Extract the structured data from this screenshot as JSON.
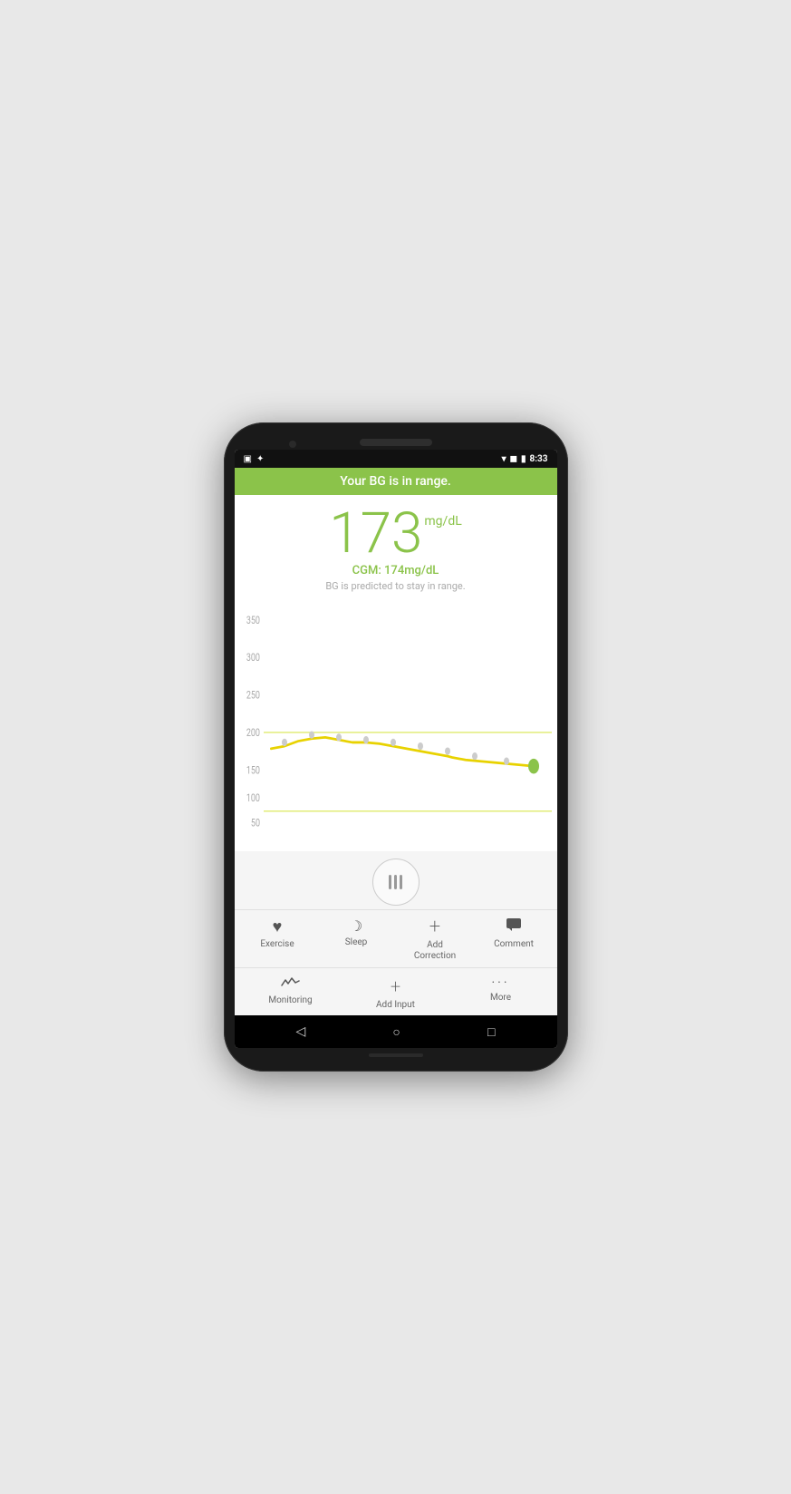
{
  "status_bar": {
    "time": "8:33",
    "icons_left": [
      "screenshot",
      "android"
    ],
    "icons_right": [
      "wifi",
      "signal",
      "battery"
    ]
  },
  "header": {
    "banner_text": "Your BG is in range."
  },
  "reading": {
    "bg_value": "173",
    "bg_unit": "mg/dL",
    "cgm_label": "CGM: 174mg/dL",
    "prediction_text": "BG is predicted to stay in range."
  },
  "chart": {
    "y_labels": [
      "350",
      "300",
      "250",
      "200",
      "150",
      "100",
      "50"
    ],
    "upper_line": 200,
    "lower_line": 80,
    "color_line": "#c8dc00",
    "color_dot_current": "#8bc34a",
    "color_trace": "#e0c800"
  },
  "drag_handle": {
    "aria": "drag-to-expand"
  },
  "quick_actions": [
    {
      "id": "exercise",
      "icon": "heart",
      "label": "Exercise"
    },
    {
      "id": "sleep",
      "icon": "moon",
      "label": "Sleep"
    },
    {
      "id": "add-correction",
      "icon": "plus",
      "label": "Add\nCorrection"
    },
    {
      "id": "comment",
      "icon": "comment",
      "label": "Comment"
    }
  ],
  "bottom_nav": [
    {
      "id": "monitoring",
      "icon": "chart",
      "label": "Monitoring"
    },
    {
      "id": "add-input",
      "icon": "plus",
      "label": "Add Input"
    },
    {
      "id": "more",
      "icon": "more",
      "label": "More"
    }
  ],
  "android_nav": {
    "back": "◁",
    "home": "○",
    "recents": "□"
  }
}
